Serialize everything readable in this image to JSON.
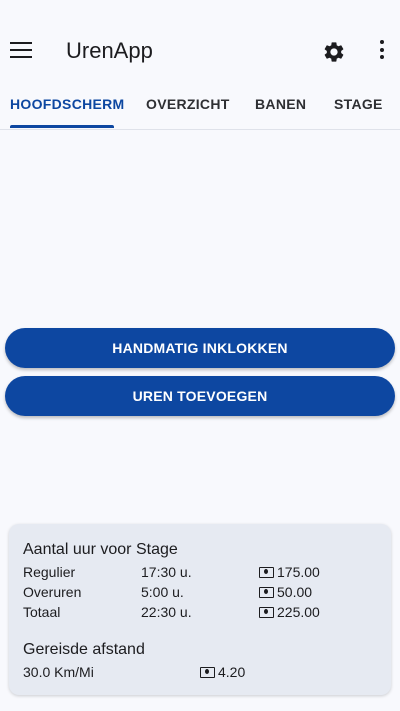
{
  "app": {
    "title": "UrenApp"
  },
  "tabs": [
    {
      "label": "HOOFDSCHERM",
      "active": true
    },
    {
      "label": "OVERZICHT",
      "active": false
    },
    {
      "label": "BANEN",
      "active": false
    },
    {
      "label": "STAGE",
      "active": false
    }
  ],
  "actions": {
    "clock_in_label": "HANDMATIG INKLOKKEN",
    "add_hours_label": "UREN TOEVOEGEN"
  },
  "summary": {
    "hours_title": "Aantal uur voor Stage",
    "rows": [
      {
        "label": "Regulier",
        "time": "17:30 u.",
        "amount": "175.00"
      },
      {
        "label": "Overuren",
        "time": "5:00  u.",
        "amount": "50.00"
      },
      {
        "label": "Totaal",
        "time": "22:30  u.",
        "amount": "225.00"
      }
    ],
    "distance_title": "Gereisde afstand",
    "distance": {
      "value": "30.0 Km/Mi",
      "amount": "4.20"
    }
  },
  "icons": [
    "menu-icon",
    "gear-icon",
    "more-vert-icon",
    "cash-icon"
  ],
  "colors": {
    "primary": "#0d47a1",
    "background": "#f8f9fd",
    "card": "#e6eaf2"
  }
}
